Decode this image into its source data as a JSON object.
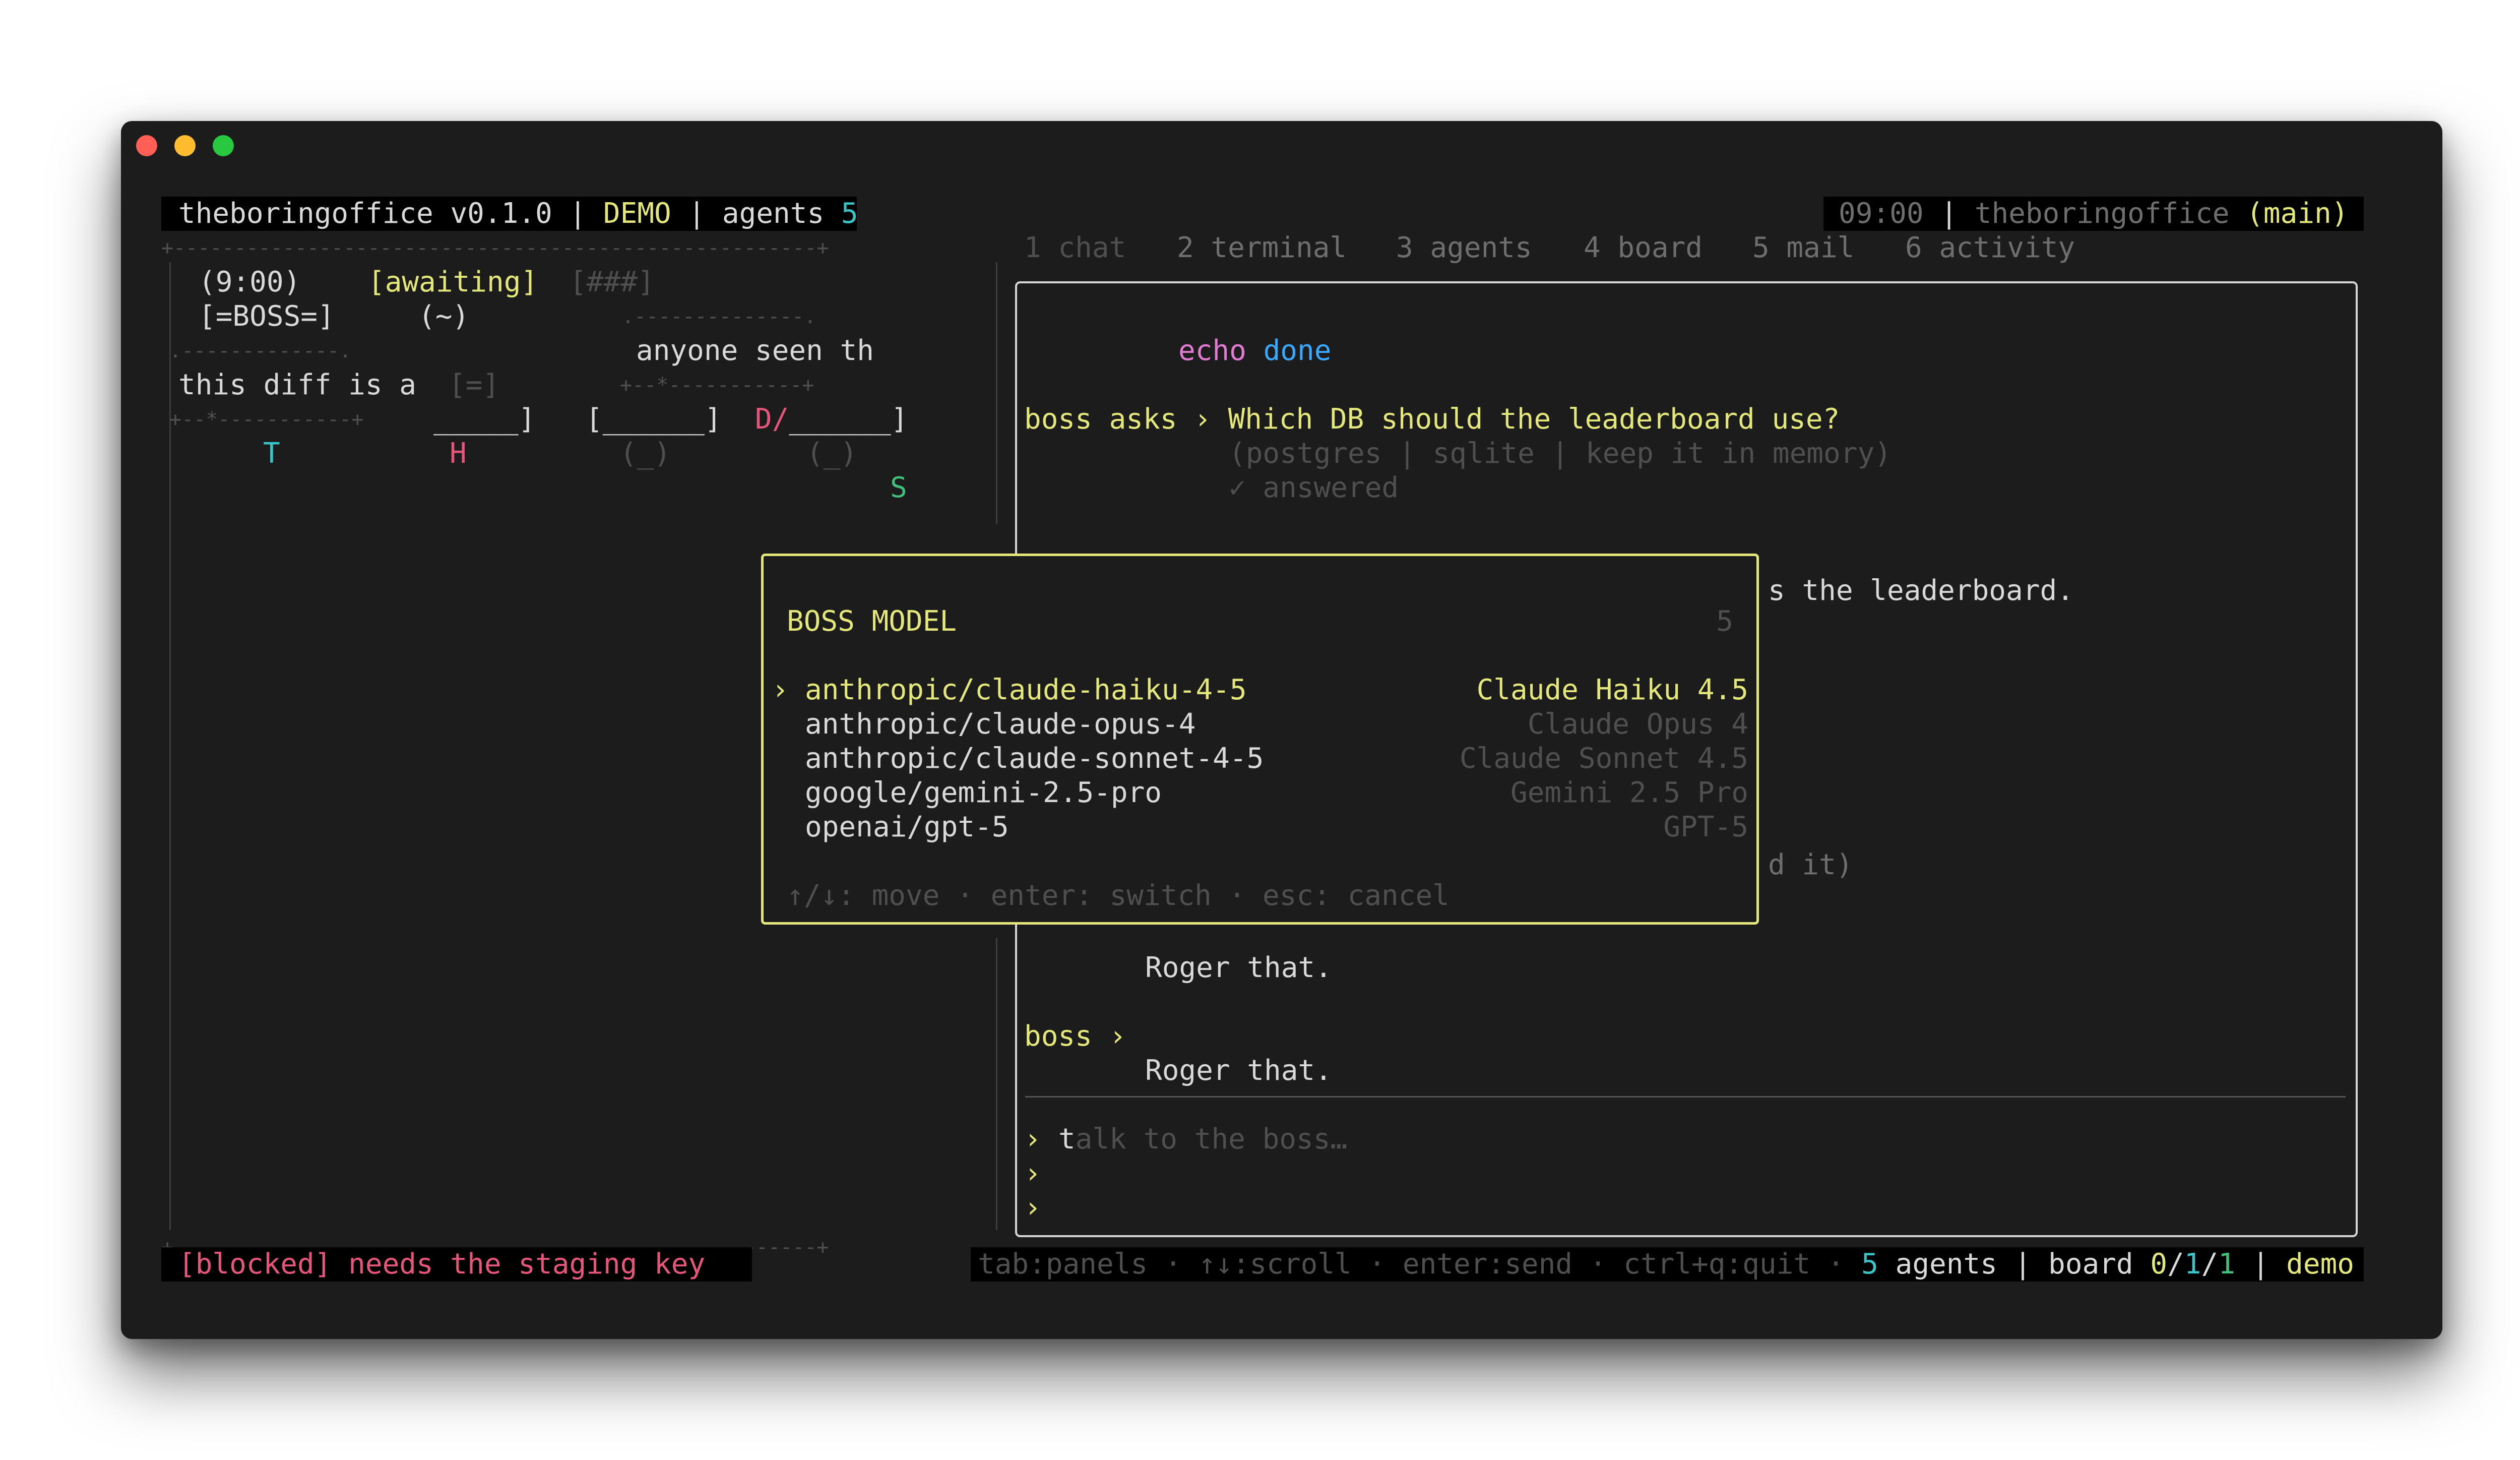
{
  "window": {
    "controls": {
      "close_color": "#ff5f57",
      "minimize_color": "#febc2e",
      "zoom_color": "#28c840"
    }
  },
  "header": {
    "app": "theboringoffice v0.1.0",
    "sep1": " | ",
    "mode": "DEMO",
    "sep2": " | ",
    "agents_label": "agents ",
    "agents_count": "5",
    "time": "09:00",
    "sep3": " | ",
    "project": "theboringoffice",
    "branch": " (main)"
  },
  "tabs": [
    "1 chat",
    "2 terminal",
    "3 agents",
    "4 board",
    "5 mail",
    "6 activity"
  ],
  "office": {
    "border_top": "+-----------------------------------------------------+",
    "border_bottom": "+-----------------------------------------------------+",
    "boss_time": "(9:00)",
    "boss_status": "[awaiting]",
    "boss_progress": "[###]",
    "boss_desk": "[=BOSS=]",
    "boss_face": "(~)",
    "bubble1_top": ".--------------.",
    "bubble1_text": "anyone seen th",
    "bubble1_bottom": "+--*-----------+",
    "bubble2_top": ".-------------.",
    "bubble2_text": "this diff is a",
    "bubble2_bottom": "+--*-----------+",
    "small_indicator": "[=]",
    "desk1": "_____]",
    "desk2": "[______]",
    "desk3_prefix": "D/",
    "desk3": "______]",
    "chair1": "(_)",
    "chair2": "(_)",
    "agent_t": "T",
    "agent_h": "H",
    "agent_s": "S"
  },
  "chat": {
    "cmd_echo": "echo",
    "cmd_done": "done",
    "boss_asks": "boss asks › ",
    "question": "Which DB should the leaderboard use?",
    "options": "(postgres | sqlite | keep it in memory)",
    "answered": "✓ answered",
    "partial_line1": "s the leaderboard.",
    "partial_line2": "d it)",
    "reply1": "Roger that.",
    "boss_prefix": "boss ›",
    "reply2": "Roger that.",
    "prompt_symbol": "›",
    "input_typed": "t",
    "input_placeholder": "alk to the boss…"
  },
  "modal": {
    "title": "BOSS MODEL",
    "count": "5",
    "selector": "›",
    "models": [
      {
        "id": "anthropic/claude-haiku-4-5",
        "name": "Claude Haiku 4.5"
      },
      {
        "id": "anthropic/claude-opus-4",
        "name": "Claude Opus 4"
      },
      {
        "id": "anthropic/claude-sonnet-4-5",
        "name": "Claude Sonnet 4.5"
      },
      {
        "id": "google/gemini-2.5-pro",
        "name": "Gemini 2.5 Pro"
      },
      {
        "id": "openai/gpt-5",
        "name": "GPT-5"
      }
    ],
    "hint": "↑/↓: move · enter: switch · esc: cancel"
  },
  "status": {
    "blocked": "[blocked] needs the staging key",
    "hints": "tab:panels · ↑↓:scroll · enter:send · ctrl+q:quit · ",
    "agents_count": "5",
    "agents_label": " agents | board ",
    "board_a": "0",
    "slash1": "/",
    "board_b": "1",
    "slash2": "/",
    "board_c": "1",
    "sep": " | ",
    "mode": "demo"
  }
}
